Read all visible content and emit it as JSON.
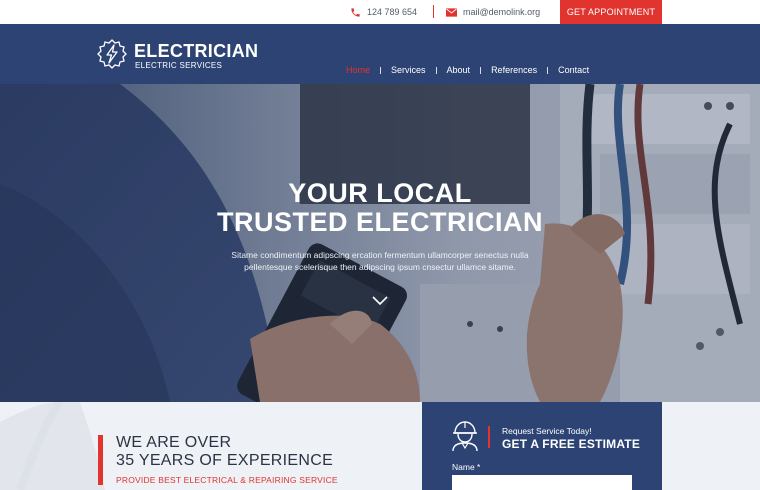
{
  "topbar": {
    "phone": "124 789 654",
    "email": "mail@demolink.org",
    "appointment_label": "GET APPOINTMENT"
  },
  "brand": {
    "title": "ELECTRICIAN",
    "subtitle": "ELECTRIC SERVICES"
  },
  "nav": {
    "items": [
      {
        "label": "Home",
        "active": true
      },
      {
        "label": "Services"
      },
      {
        "label": "About"
      },
      {
        "label": "References"
      },
      {
        "label": "Contact"
      }
    ]
  },
  "hero": {
    "title_line1": "YOUR LOCAL",
    "title_line2": "TRUSTED ELECTRICIAN",
    "text": "Sitame condimentum adipscing ercation fermentum ullamcorper senectus nulla pellentesque scelerisque then adipscing ipsum cnsectur ullamce sitame."
  },
  "experience": {
    "line1": "WE ARE OVER",
    "line2": "35 YEARS OF EXPERIENCE",
    "subtitle": "PROVIDE BEST ELECTRICAL & REPAIRING SERVICE"
  },
  "estimate": {
    "request_label": "Request Service Today!",
    "title": "GET A FREE ESTIMATE",
    "name_label": "Name *",
    "name_value": ""
  },
  "colors": {
    "accent": "#e2342f",
    "navy": "#2c4373",
    "light_bg": "#eef1f5"
  }
}
